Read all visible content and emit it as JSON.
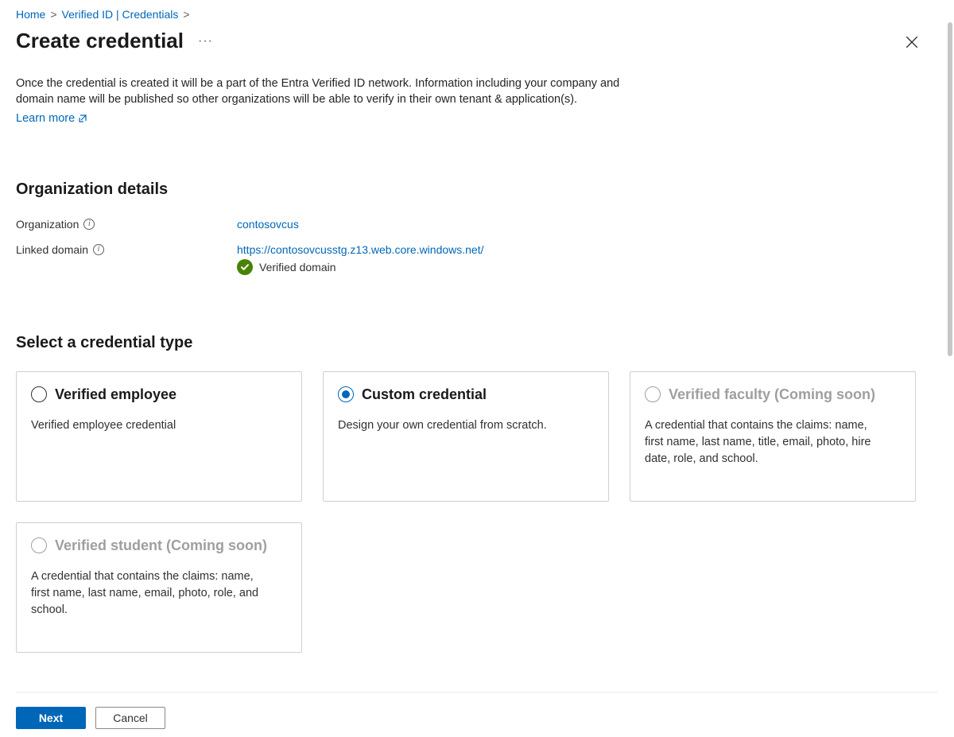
{
  "breadcrumb": {
    "home": "Home",
    "verified_id": "Verified ID | Credentials"
  },
  "title": "Create credential",
  "intro": "Once the credential is created it will be a part of the Entra Verified ID network. Information including your company and domain name will be published so other organizations will be able to verify in their own tenant & application(s).",
  "learn_more": "Learn more",
  "org_section_title": "Organization details",
  "org_label": "Organization",
  "org_value": "contosovcus",
  "domain_label": "Linked domain",
  "domain_value": "https://contosovcusstg.z13.web.core.windows.net/",
  "verified_text": "Verified domain",
  "select_title": "Select a credential type",
  "cards": {
    "employee": {
      "title": "Verified employee",
      "desc": "Verified employee credential"
    },
    "custom": {
      "title": "Custom credential",
      "desc": "Design your own credential from scratch."
    },
    "faculty": {
      "title": "Verified faculty (Coming soon)",
      "desc": "A credential that contains the claims: name, first name, last name, title, email, photo, hire date, role, and school."
    },
    "student": {
      "title": "Verified student (Coming soon)",
      "desc": "A credential that contains the claims: name, first name, last name, email, photo, role, and school."
    }
  },
  "footer": {
    "next": "Next",
    "cancel": "Cancel"
  }
}
